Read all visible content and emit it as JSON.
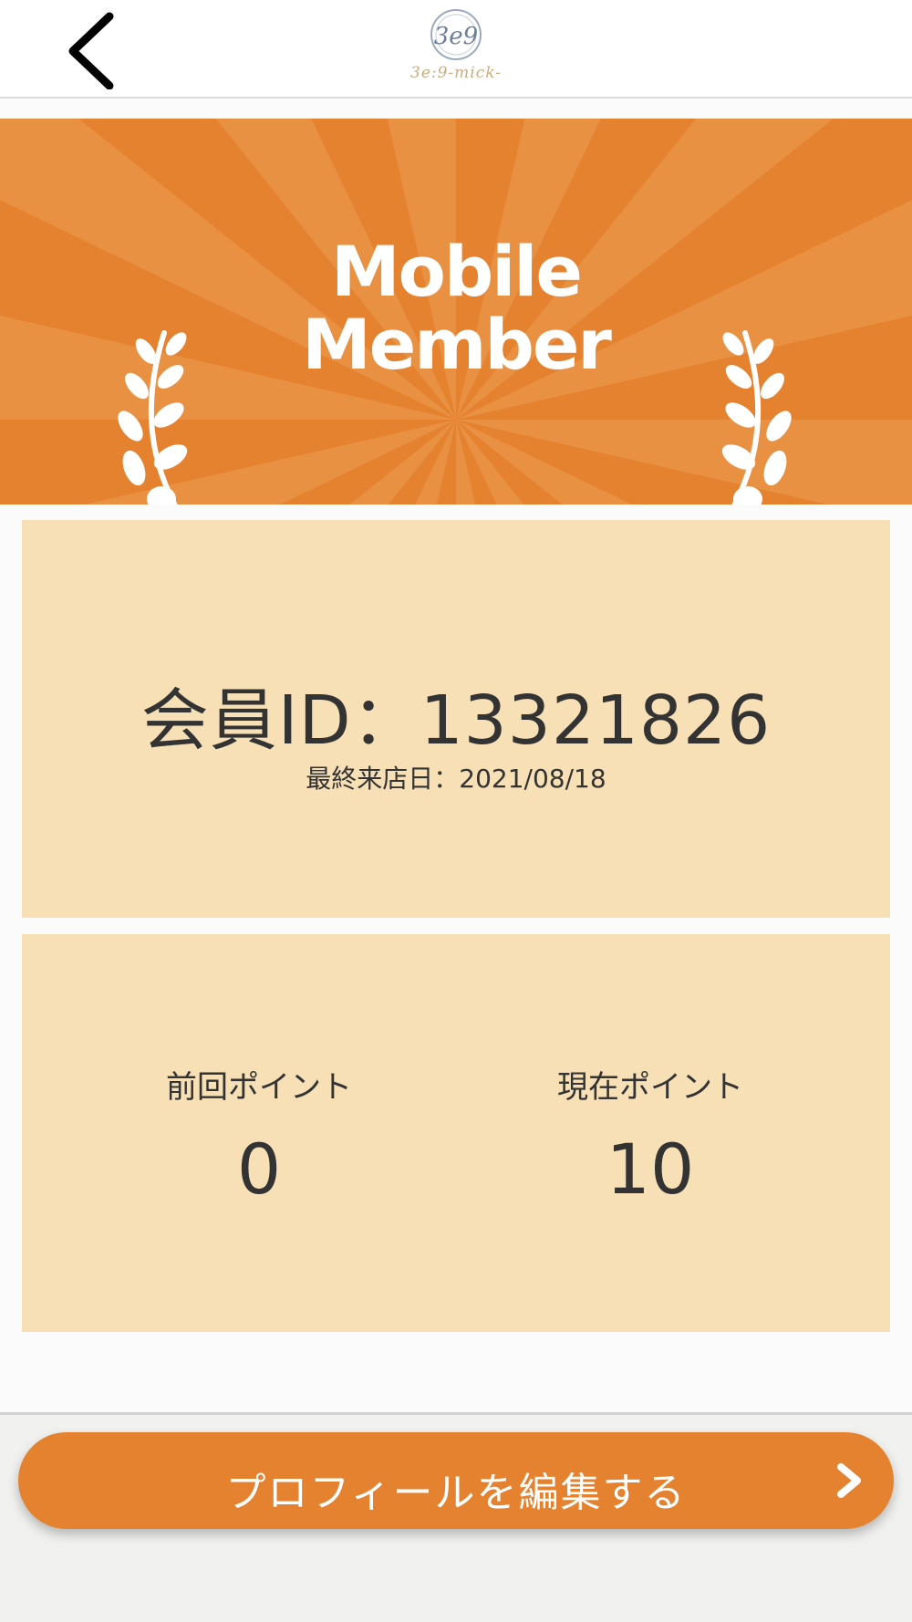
{
  "header": {
    "logo_text": "3e:9-mick-",
    "logo_monogram": "3e9"
  },
  "banner": {
    "title_line1": "Mobile",
    "title_line2": "Member"
  },
  "member_card": {
    "id_text": "会員ID：13321826",
    "last_visit_text": "最終来店日：2021/08/18"
  },
  "points": {
    "previous_label": "前回ポイント",
    "previous_value": "0",
    "current_label": "現在ポイント",
    "current_value": "10"
  },
  "actions": {
    "edit_profile_label": "プロフィールを編集する"
  },
  "colors": {
    "accent": "#e5822f",
    "card_bg": "#f7dfb6",
    "text": "#333333"
  },
  "icons": {
    "back": "chevron-left-icon",
    "edit_arrow": "chevron-right-icon",
    "laurel": "laurel-branch-icon"
  }
}
